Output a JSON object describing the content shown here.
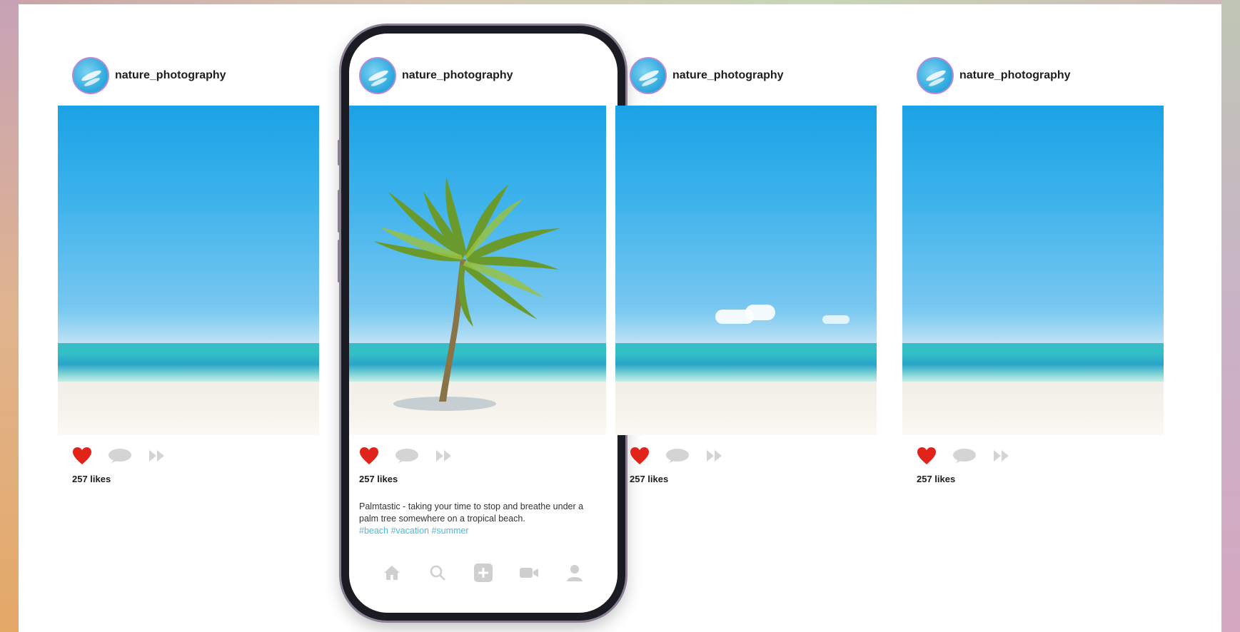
{
  "posts": [
    {
      "username": "nature_photography",
      "likes": "257 likes"
    },
    {
      "username": "nature_photography",
      "likes": "257 likes",
      "caption": "Palmtastic - taking your time to stop and breathe under a palm tree somewhere on a tropical beach.",
      "hashtags": "#beach #vacation #summer"
    },
    {
      "username": "nature_photography",
      "likes": "257 likes"
    },
    {
      "username": "nature_photography",
      "likes": "257 likes"
    }
  ],
  "icons": {
    "like": "heart-icon",
    "comment": "comment-icon",
    "share": "share-icon",
    "nav": [
      "home-icon",
      "search-icon",
      "add-post-icon",
      "reels-icon",
      "profile-icon"
    ]
  },
  "colors": {
    "like_red": "#e2231a",
    "hashtag_blue": "#4fb7d8",
    "icon_gray": "#c9c9c9",
    "sky": "#1aa2e6",
    "phone_frame": "#1b1b23"
  }
}
